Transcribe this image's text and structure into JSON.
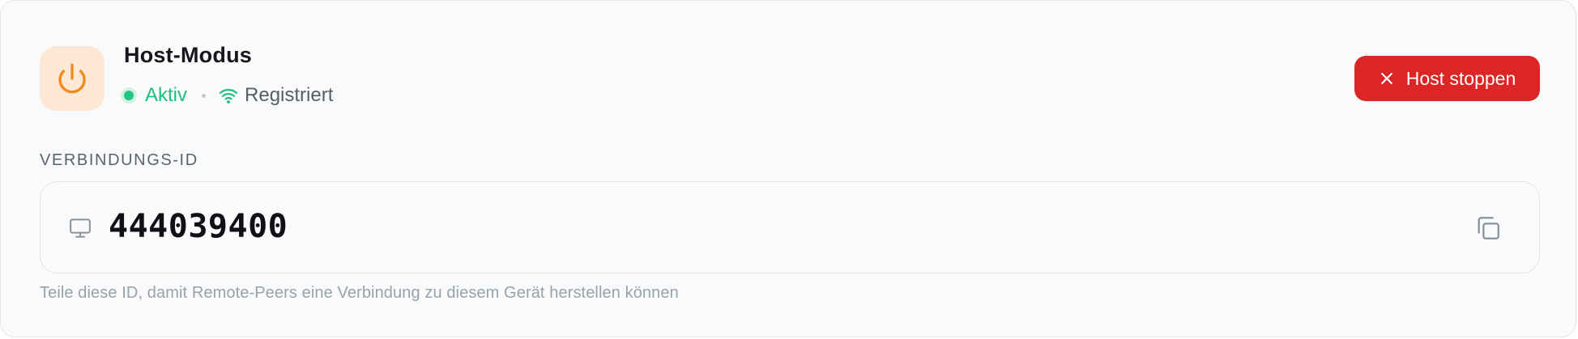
{
  "host": {
    "title": "Host-Modus",
    "status_active": "Aktiv",
    "status_registered": "Registriert",
    "stop_label": "Host stoppen"
  },
  "connection": {
    "label": "VERBINDUNGS-ID",
    "id": "444039400",
    "helper": "Teile diese ID, damit Remote-Peers eine Verbindung zu diesem Gerät herstellen können"
  },
  "icons": {
    "power": "power-icon",
    "wifi": "wifi-icon",
    "close": "close-icon",
    "monitor": "monitor-icon",
    "copy": "copy-icon"
  },
  "colors": {
    "accent_orange": "#f28a16",
    "power_tile_bg": "#fde8d6",
    "active_green": "#1fbf7c",
    "danger_red": "#dc2626"
  }
}
